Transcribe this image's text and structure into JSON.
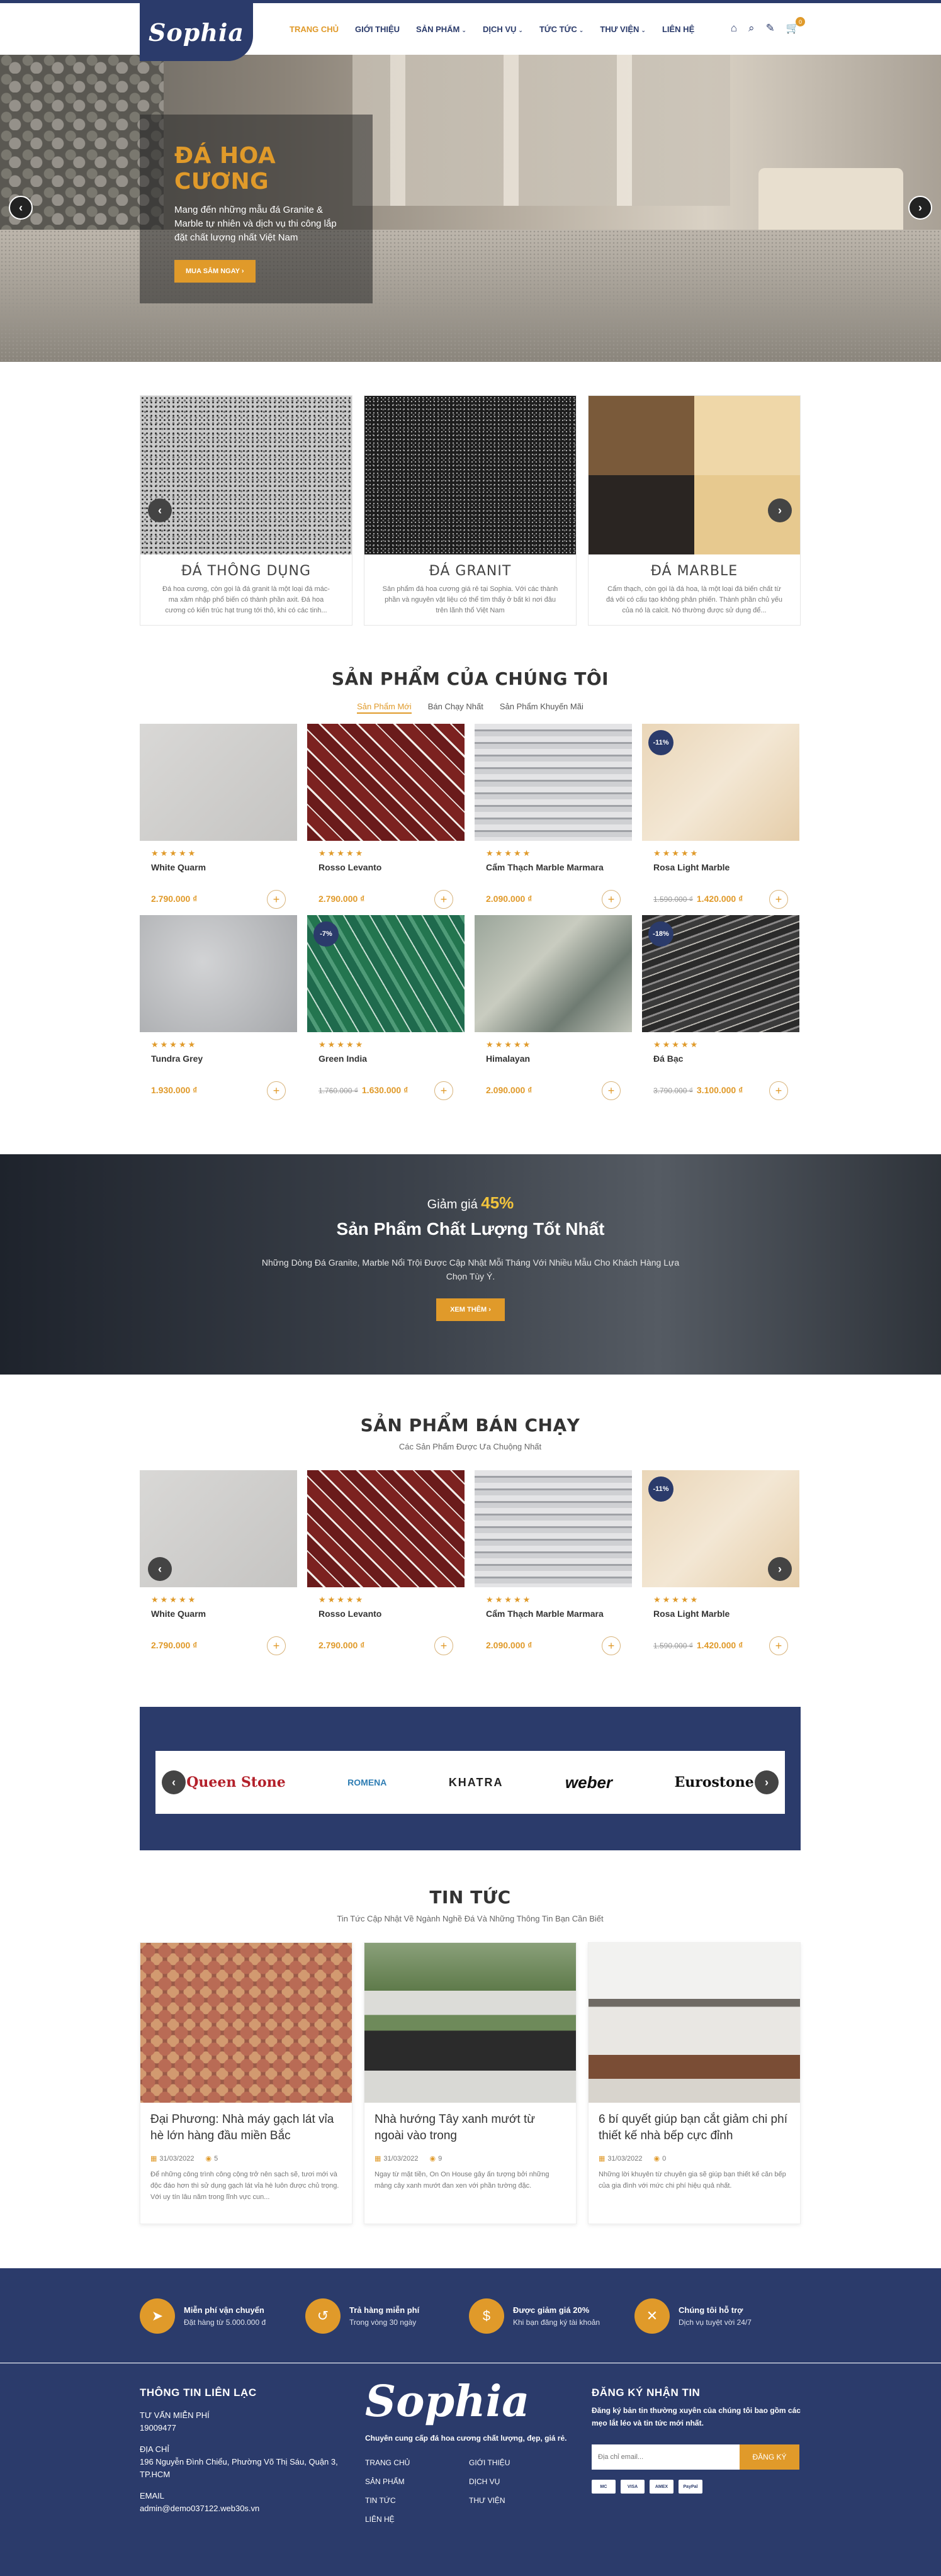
{
  "header": {
    "logo": "Sophia",
    "nav": [
      {
        "label": "TRANG CHỦ",
        "active": true,
        "caret": false
      },
      {
        "label": "GIỚI THIỆU",
        "active": false,
        "caret": false
      },
      {
        "label": "SẢN PHẨM",
        "active": false,
        "caret": true
      },
      {
        "label": "DỊCH VỤ",
        "active": false,
        "caret": true
      },
      {
        "label": "TỨC TỨC",
        "active": false,
        "caret": true
      },
      {
        "label": "THƯ VIỆN",
        "active": false,
        "caret": true
      },
      {
        "label": "LIÊN HỆ",
        "active": false,
        "caret": false
      }
    ],
    "cart_count": "0"
  },
  "hero": {
    "title": "ĐÁ HOA CƯƠNG",
    "desc": "Mang đến những mẫu đá Granite & Marble tự nhiên và dịch vụ thi công lắp đặt chất lượng nhất Việt Nam",
    "button": "MUA SẮM NGAY"
  },
  "categories": [
    {
      "name": "ĐÁ THÔNG DỤNG",
      "desc": "Đá hoa cương, còn gọi là đá granit là một loại đá mác-ma xâm nhập phổ biến có thành phần axit. Đá hoa cương có kiến trúc hạt trung tới thô, khi có các tinh..."
    },
    {
      "name": "ĐÁ GRANIT",
      "desc": "Sản phẩm đá hoa cương giá rẻ tại Sophia. Với các thành phần và nguyên vật liệu có thể tìm thấy ở bất kì nơi đâu trên lãnh thổ Việt Nam"
    },
    {
      "name": "ĐÁ MARBLE",
      "desc": "Cẩm thạch, còn gọi là đá hoa, là một loại đá biến chất từ đá vôi có cấu tạo không phân phiến. Thành phần chủ yếu của nó là calcit. Nó thường được sử dụng để..."
    }
  ],
  "products_section": {
    "title": "SẢN PHẨM CỦA CHÚNG TÔI",
    "tabs": [
      "Sản Phẩm Mới",
      "Bán Chạy Nhất",
      "Sản Phẩm Khuyến Mãi"
    ],
    "items": [
      {
        "name": "White Quarm",
        "price": "2.790.000 ₫",
        "old": "",
        "badge": "",
        "tex": "tex-gray"
      },
      {
        "name": "Rosso Levanto",
        "price": "2.790.000 ₫",
        "old": "",
        "badge": "",
        "tex": "tex-red"
      },
      {
        "name": "Cẩm Thạch Marble Marmara",
        "price": "2.090.000 ₫",
        "old": "",
        "badge": "",
        "tex": "tex-lines"
      },
      {
        "name": "Rosa Light Marble",
        "price": "1.420.000 ₫",
        "old": "1.590.000 ₫",
        "badge": "-11%",
        "tex": "tex-beige"
      },
      {
        "name": "Tundra Grey",
        "price": "1.930.000 ₫",
        "old": "",
        "badge": "",
        "tex": "tex-grey2"
      },
      {
        "name": "Green India",
        "price": "1.630.000 ₫",
        "old": "1.760.000 ₫",
        "badge": "-7%",
        "tex": "tex-green"
      },
      {
        "name": "Himalayan",
        "price": "2.090.000 ₫",
        "old": "",
        "badge": "",
        "tex": "tex-hima"
      },
      {
        "name": "Đá Bạc",
        "price": "3.100.000 ₫",
        "old": "3.790.000 ₫",
        "badge": "-18%",
        "tex": "tex-black"
      }
    ]
  },
  "promo": {
    "prefix": "Giảm giá",
    "percent": "45%",
    "title": "Sản Phẩm Chất Lượng Tốt Nhất",
    "desc": "Những Dòng Đá Granite, Marble Nổi Trội Được Cập Nhật Mỗi Tháng Với Nhiều Mẫu Cho Khách Hàng Lựa Chọn Tùy Ý.",
    "button": "XEM THÊM"
  },
  "bestseller": {
    "title": "SẢN PHẨM BÁN CHẠY",
    "subtitle": "Các Sản Phẩm Được Ưa Chuộng Nhất",
    "items": [
      {
        "name": "White Quarm",
        "price": "2.790.000 ₫",
        "old": "",
        "badge": "",
        "tex": "tex-gray"
      },
      {
        "name": "Rosso Levanto",
        "price": "2.790.000 ₫",
        "old": "",
        "badge": "",
        "tex": "tex-red"
      },
      {
        "name": "Cẩm Thạch Marble Marmara",
        "price": "2.090.000 ₫",
        "old": "",
        "badge": "",
        "tex": "tex-lines"
      },
      {
        "name": "Rosa Light Marble",
        "price": "1.420.000 ₫",
        "old": "1.590.000 ₫",
        "badge": "-11%",
        "tex": "tex-beige"
      }
    ]
  },
  "partners": [
    "Queen Stone",
    "ROMENA",
    "KHATRA",
    "weber",
    "Eurostone"
  ],
  "news": {
    "title": "TIN TỨC",
    "subtitle": "Tin Tức Cập Nhật Về Ngành Nghề Đá Và Những Thông Tin Bạn Cần Biết",
    "items": [
      {
        "title": "Đại Phương: Nhà máy gạch lát vỉa hè lớn hàng đầu miền Bắc",
        "date": "31/03/2022",
        "views": "5",
        "excerpt": "Để những công trình công cộng trở nên sạch sẽ, tươi mới và độc đáo hơn thì sử dụng gạch lát vỉa hè luôn được chủ trọng. Với uy tín lâu năm trong lĩnh vực cun...",
        "img": "n1"
      },
      {
        "title": "Nhà hướng Tây xanh mướt từ ngoài vào trong",
        "date": "31/03/2022",
        "views": "9",
        "excerpt": "Ngay từ mặt tiền, On On House gây ấn tượng bởi những mảng cây xanh mướt đan xen với phần tường đặc.",
        "img": "n2"
      },
      {
        "title": "6 bí quyết giúp bạn cắt giảm chi phí thiết kế nhà bếp cực đỉnh",
        "date": "31/03/2022",
        "views": "0",
        "excerpt": "Những lời khuyên từ chuyên gia sẽ giúp bạn thiết kế căn bếp của gia đình với mức chi phí hiệu quả nhất.",
        "img": "n3"
      }
    ]
  },
  "features": [
    {
      "icon": "➤",
      "title": "Miễn phí vận chuyển",
      "sub": "Đặt hàng từ 5.000.000 đ"
    },
    {
      "icon": "↺",
      "title": "Trả hàng miễn phí",
      "sub": "Trong vòng 30 ngày"
    },
    {
      "icon": "$",
      "title": "Được giảm giá 20%",
      "sub": "Khi bạn đăng ký tài khoản"
    },
    {
      "icon": "✕",
      "title": "Chúng tôi hỗ trợ",
      "sub": "Dịch vụ tuyệt vời 24/7"
    }
  ],
  "footer": {
    "contact_title": "THÔNG TIN LIÊN LẠC",
    "hotline_label": "TƯ VẤN MIỄN PHÍ",
    "hotline": "19009477",
    "address_label": "ĐỊA CHỈ",
    "address": "196 Nguyễn Đình Chiểu, Phường Võ Thị Sáu, Quận 3, TP.HCM",
    "email_label": "EMAIL",
    "email": "admin@demo037122.web30s.vn",
    "logo": "Sophia",
    "tagline": "Chuyên cung cấp đá hoa cương chất lượng, đẹp, giá rẻ.",
    "links": [
      "TRANG CHỦ",
      "GIỚI THIỆU",
      "SẢN PHẨM",
      "DỊCH VỤ",
      "TIN TỨC",
      "THƯ VIỆN",
      "LIÊN HỆ"
    ],
    "newsletter_title": "ĐĂNG KÝ NHẬN TIN",
    "newsletter_desc": "Đăng ký bản tin thường xuyên của chúng tôi bao gồm các mẹo lắt léo và tin tức mới nhất.",
    "email_placeholder": "Địa chỉ email...",
    "subscribe": "ĐĂNG KÝ",
    "payments": [
      "MC",
      "VISA",
      "AMEX",
      "PayPal"
    ]
  }
}
